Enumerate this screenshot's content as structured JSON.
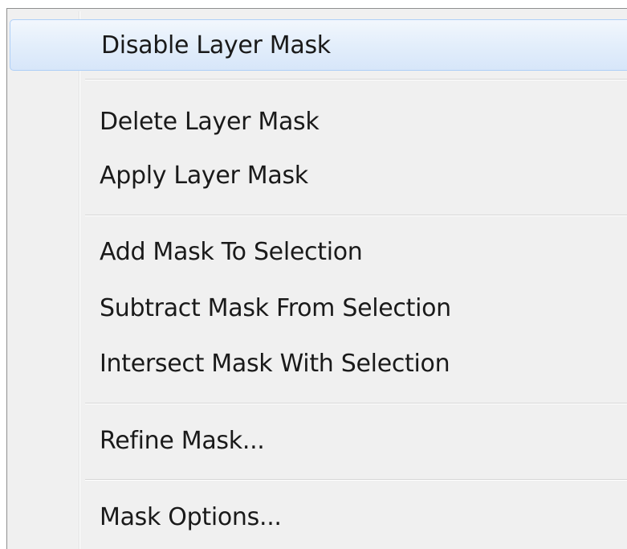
{
  "menu": {
    "items": [
      {
        "label": "Disable Layer Mask",
        "highlighted": true
      },
      {
        "label": "Delete Layer Mask"
      },
      {
        "label": "Apply Layer Mask"
      },
      {
        "label": "Add Mask To Selection"
      },
      {
        "label": "Subtract Mask From Selection"
      },
      {
        "label": "Intersect Mask With Selection"
      },
      {
        "label": "Refine Mask..."
      },
      {
        "label": "Mask Options..."
      }
    ]
  },
  "colors": {
    "menu_background": "#f0f0f0",
    "highlight_border": "#aecff7",
    "highlight_fill": "#dfeafa",
    "text": "#1a1a1a"
  }
}
